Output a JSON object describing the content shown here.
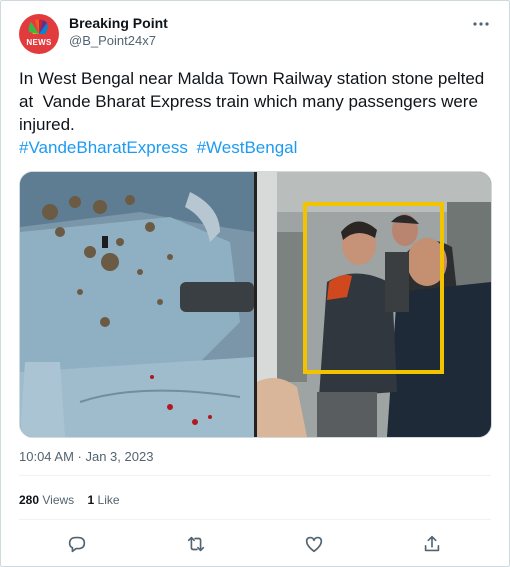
{
  "author": {
    "name": "Breaking Point",
    "handle": "@B_Point24x7",
    "avatar_text": "NEWS",
    "avatar_color": "#e23b3e"
  },
  "tweet": {
    "text": "In West Bengal near Malda Town Railway station stone pelted at  Vande Bharat Express train which many passengers were injured.",
    "hashtags": [
      "#VandeBharatExpress",
      "#WestBengal"
    ],
    "timestamp": "10:04 AM · Jan 3, 2023"
  },
  "stats": {
    "views_count": "280",
    "views_label": "Views",
    "likes_count": "1",
    "likes_label": "Like"
  },
  "icons": {
    "more": "more-dots-icon",
    "reply": "reply-icon",
    "retweet": "retweet-icon",
    "like": "like-icon",
    "share": "share-icon"
  },
  "colors": {
    "hashtag": "#1d9bf0",
    "highlight_box": "#f2c400",
    "secondary_text": "#536471"
  }
}
